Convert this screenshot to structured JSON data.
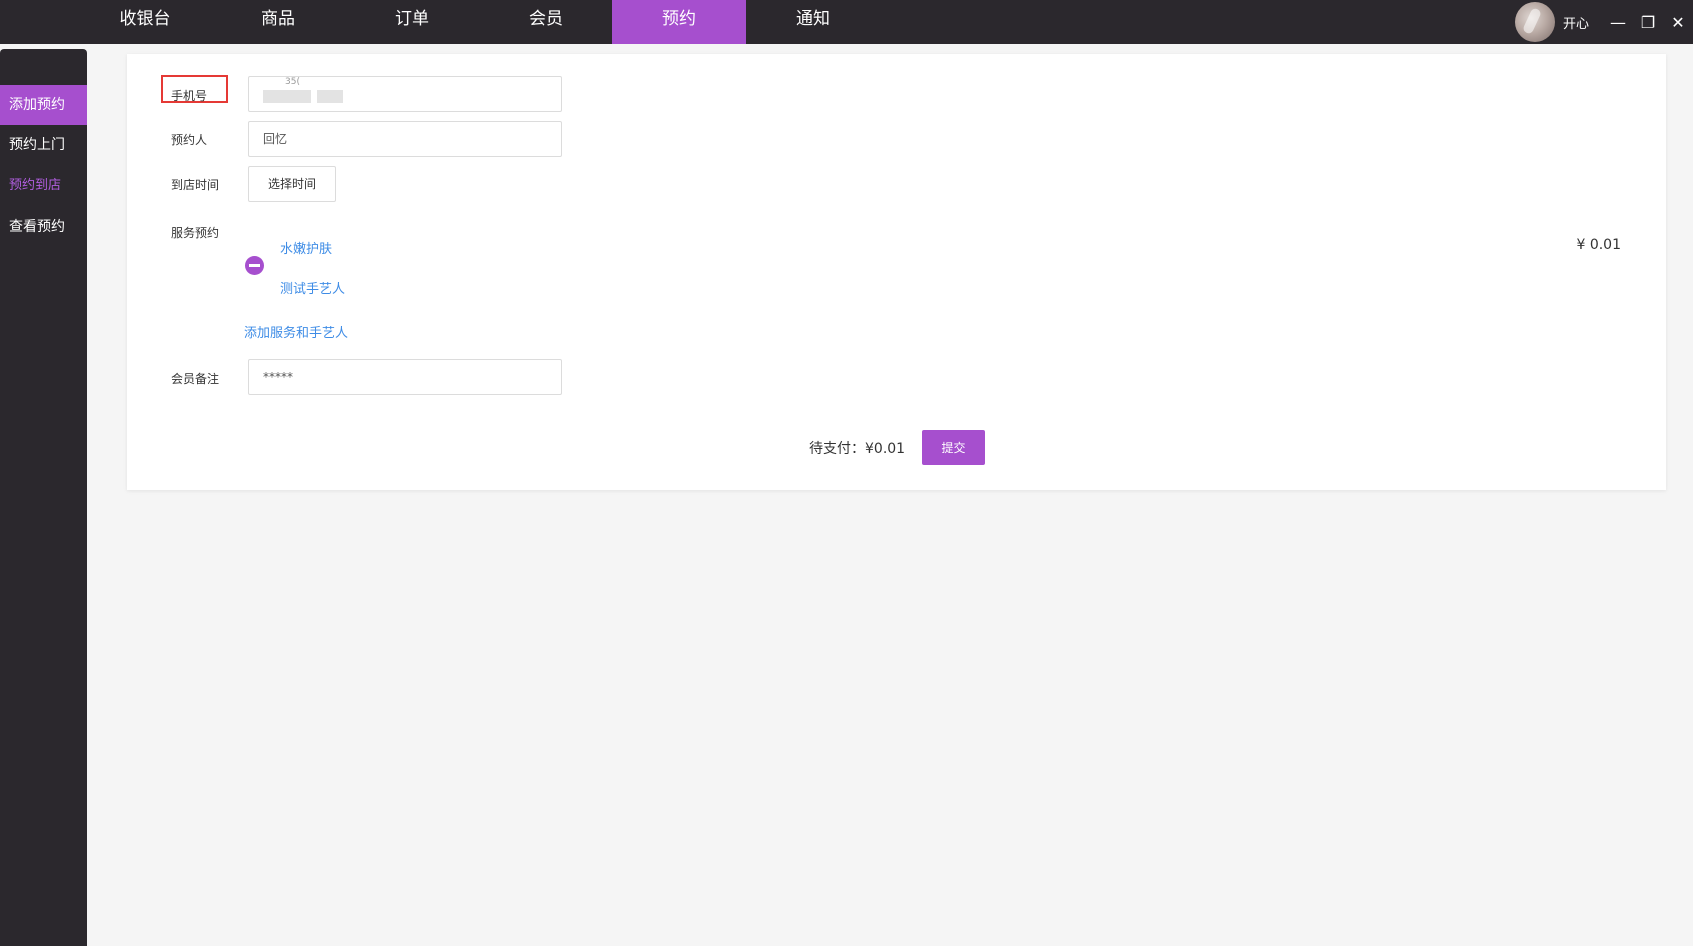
{
  "nav": {
    "items": [
      {
        "label": "收银台"
      },
      {
        "label": "商品"
      },
      {
        "label": "订单"
      },
      {
        "label": "会员"
      },
      {
        "label": "预约"
      },
      {
        "label": "通知"
      }
    ],
    "active_index": 4
  },
  "user": {
    "name": "开心"
  },
  "window_controls": {
    "minimize": "—",
    "restore": "❐",
    "close": "✕"
  },
  "sidebar": {
    "items": [
      {
        "label": "添加预约"
      },
      {
        "label": "预约上门"
      },
      {
        "label": "预约到店"
      },
      {
        "label": "查看预约"
      }
    ],
    "active_index": 0
  },
  "form": {
    "phone": {
      "label": "手机号",
      "value_partial": "35("
    },
    "booker": {
      "label": "预约人",
      "value": "回忆"
    },
    "arrival_time": {
      "label": "到店时间",
      "button": "选择时间"
    },
    "service": {
      "label": "服务预约",
      "service_name": "水嫩护肤",
      "artisan_name": "测试手艺人",
      "price": "¥ 0.01",
      "add_link": "添加服务和手艺人"
    },
    "note": {
      "label": "会员备注",
      "value": "*****"
    }
  },
  "footer": {
    "pay_label": "待支付：¥0.01",
    "submit": "提交"
  },
  "colors": {
    "accent": "#a64fce",
    "dark": "#2b282d",
    "link": "#3e8ce6",
    "highlight_box": "#e53935"
  }
}
